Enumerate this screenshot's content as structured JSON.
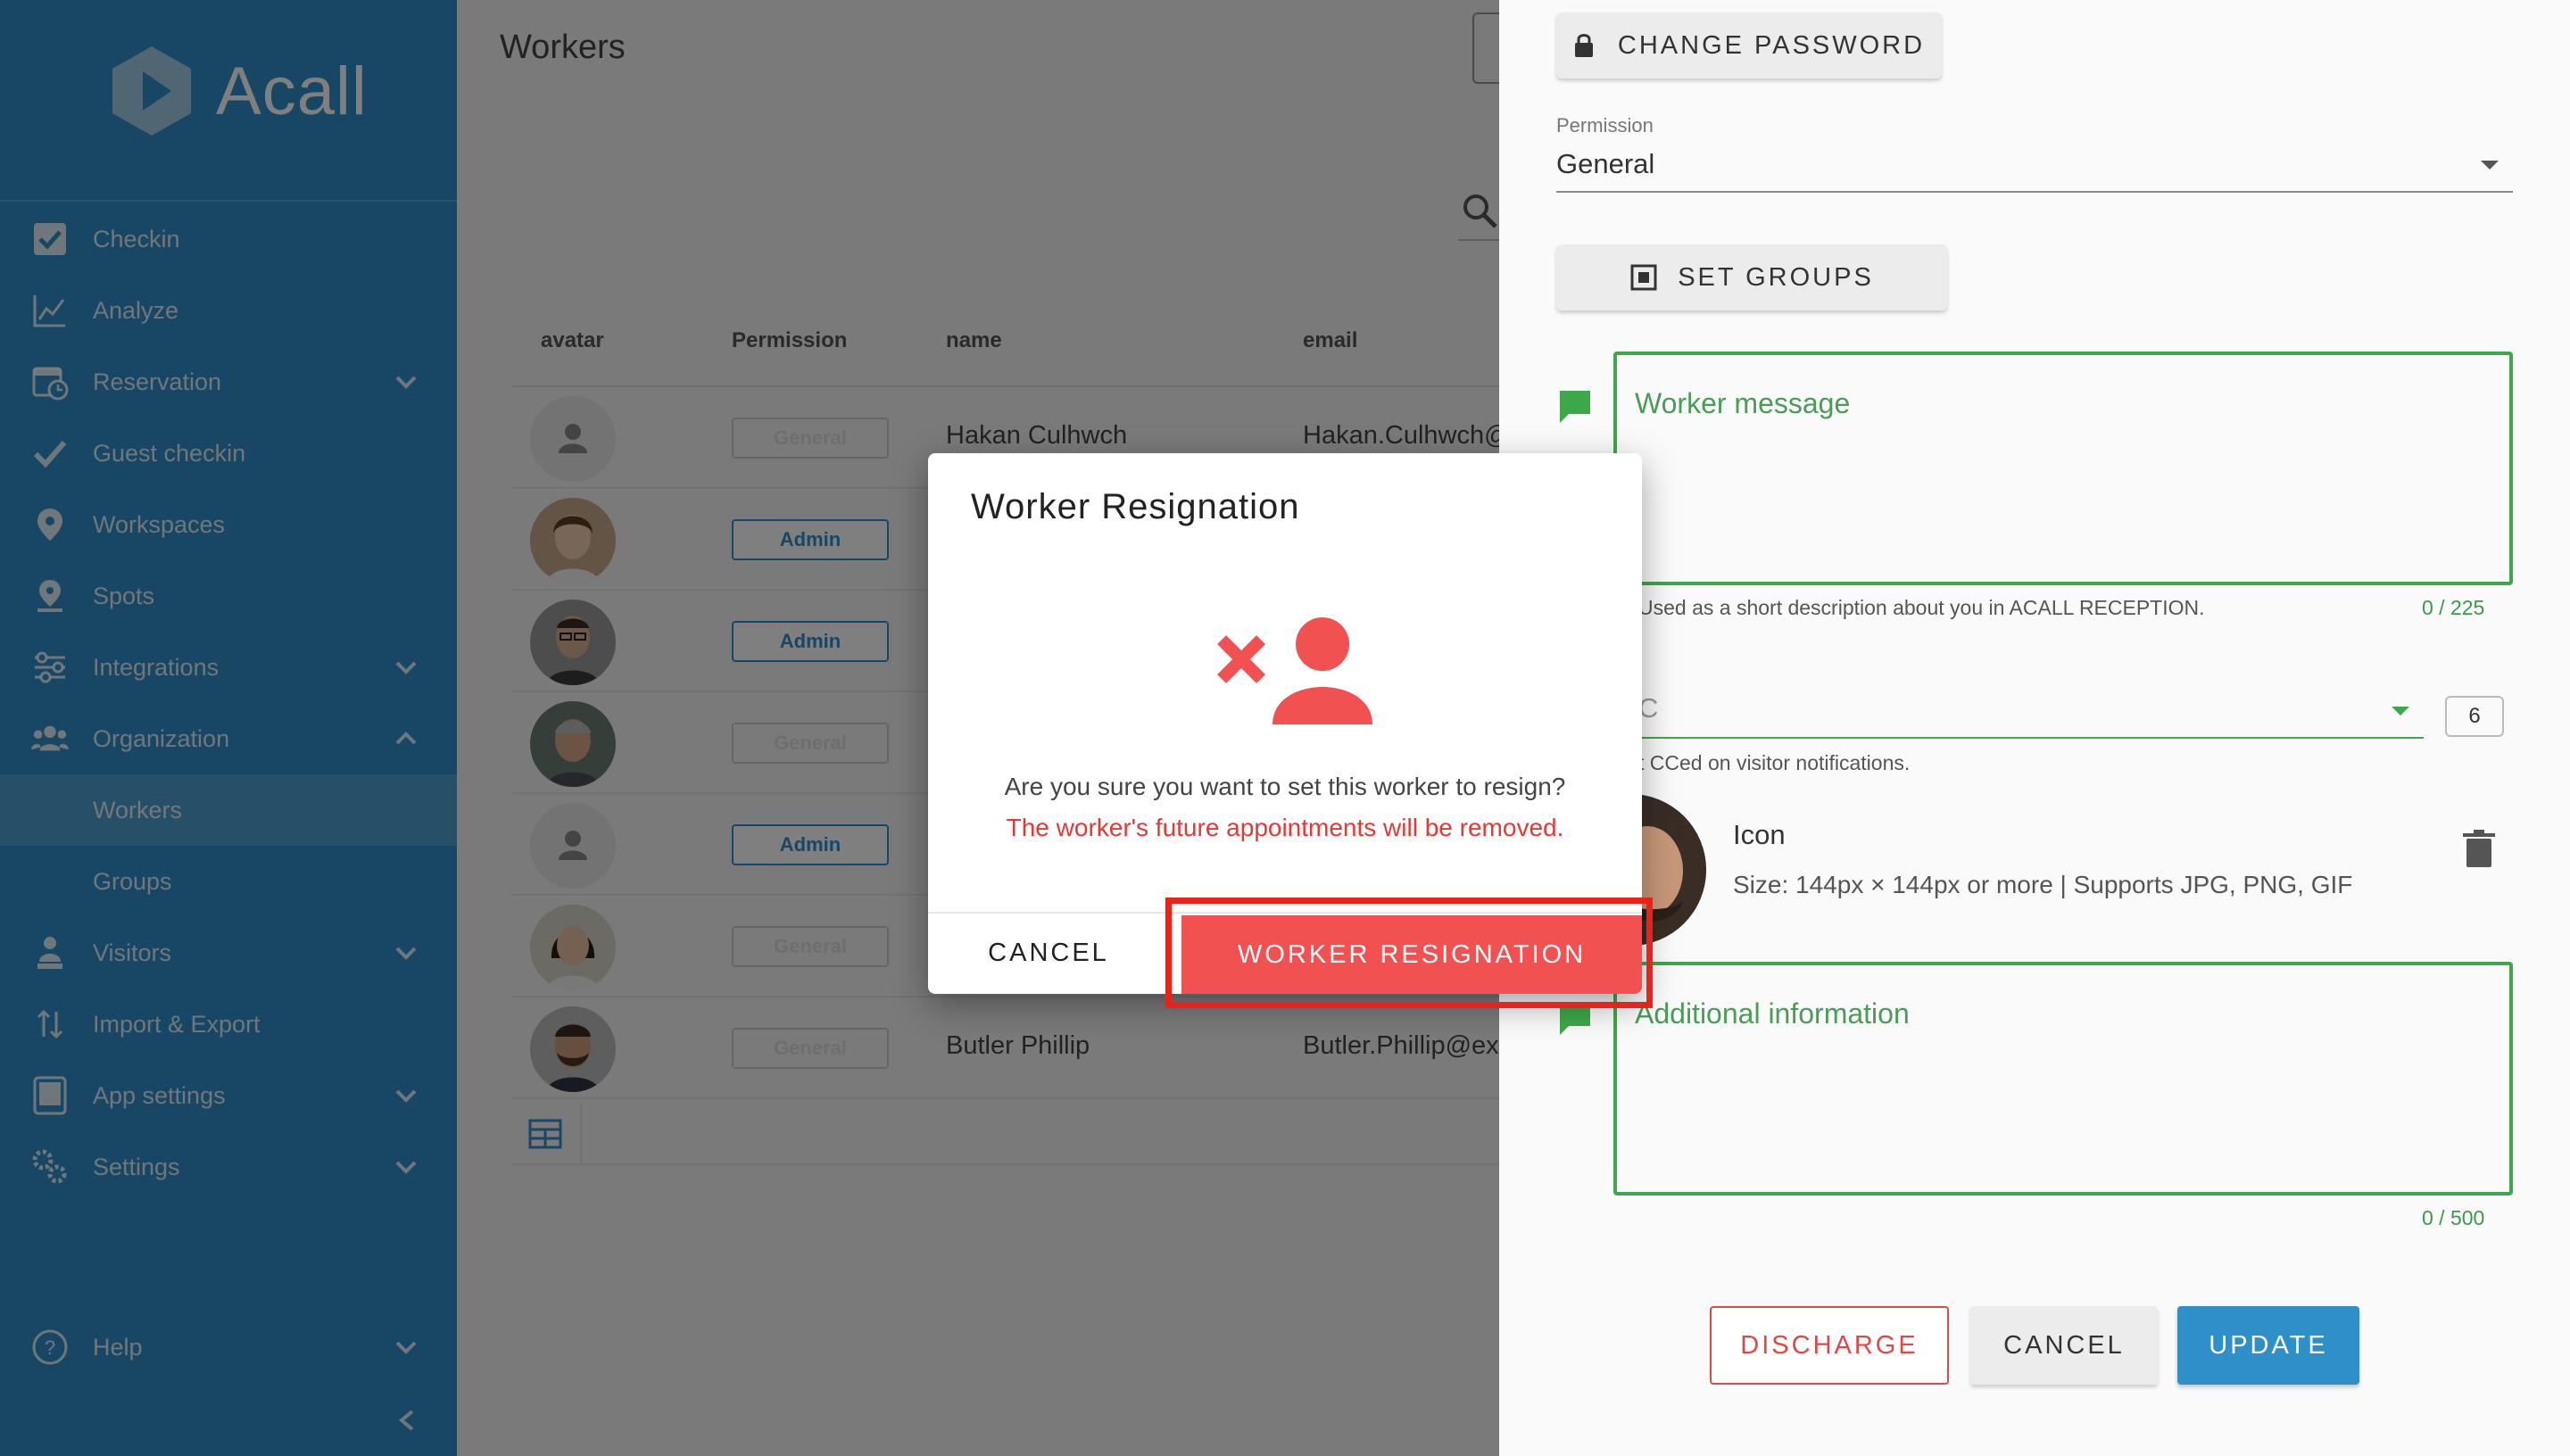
{
  "app": {
    "logo_text": "Acall"
  },
  "sidebar": {
    "items": [
      {
        "label": "Checkin",
        "icon": "checkbox-icon"
      },
      {
        "label": "Analyze",
        "icon": "chart-line-icon"
      },
      {
        "label": "Reservation",
        "icon": "calendar-clock-icon",
        "expandable": true
      },
      {
        "label": "Guest checkin",
        "icon": "check-icon"
      },
      {
        "label": "Workspaces",
        "icon": "location-pin-icon"
      },
      {
        "label": "Spots",
        "icon": "spot-pin-icon"
      },
      {
        "label": "Integrations",
        "icon": "integrations-icon",
        "expandable": true
      },
      {
        "label": "Organization",
        "icon": "people-icon",
        "expanded": true
      },
      {
        "label": "Workers",
        "sub": true,
        "active": true
      },
      {
        "label": "Groups",
        "sub": true
      },
      {
        "label": "Visitors",
        "icon": "visitor-icon",
        "expandable": true
      },
      {
        "label": "Import & Export",
        "icon": "import-export-icon"
      },
      {
        "label": "App settings",
        "icon": "tablet-icon",
        "expandable": true
      },
      {
        "label": "Settings",
        "icon": "gears-icon",
        "expandable": true
      }
    ],
    "help_label": "Help"
  },
  "main": {
    "title": "Workers",
    "columns": [
      "avatar",
      "Permission",
      "name",
      "email"
    ],
    "rows": [
      {
        "permission": "General",
        "name": "Hakan Culhwch",
        "email": "Hakan.Culhwch@e"
      },
      {
        "permission": "Admin",
        "name": "",
        "email": ""
      },
      {
        "permission": "Admin",
        "name": "",
        "email": ""
      },
      {
        "permission": "General",
        "name": "",
        "email": ""
      },
      {
        "permission": "Admin",
        "name": "",
        "email": ""
      },
      {
        "permission": "General",
        "name": "",
        "email": ""
      },
      {
        "permission": "General",
        "name": "Butler Phillip",
        "email": "Butler.Phillip@exar"
      }
    ]
  },
  "panel": {
    "change_password": "CHANGE PASSWORD",
    "permission_label": "Permission",
    "permission_value": "General",
    "set_groups": "SET GROUPS",
    "worker_message_placeholder": "Worker message",
    "worker_message_helper": "Used as a short description about you in ACALL RECEPTION.",
    "worker_message_counter": "0 / 225",
    "cc_value": "C",
    "cc_count": "6",
    "cc_helper": "t CCed on visitor notifications.",
    "icon_title": "Icon",
    "icon_subtitle": "Size: 144px × 144px or more | Supports JPG, PNG, GIF",
    "additional_placeholder": "Additional information",
    "additional_counter": "0 / 500",
    "discharge": "DISCHARGE",
    "cancel": "CANCEL",
    "update": "UPDATE"
  },
  "dialog": {
    "title": "Worker Resignation",
    "question": "Are you sure you want to set this worker to resign?",
    "warning": "The worker's future appointments will be removed.",
    "cancel": "CANCEL",
    "confirm": "WORKER RESIGNATION"
  },
  "colors": {
    "brand": "#2f8fc9",
    "danger": "#f25152",
    "success": "#3da84a"
  }
}
